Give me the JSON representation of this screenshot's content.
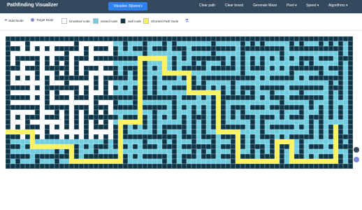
{
  "navbar": {
    "brand": "Pathfinding Visualizer",
    "visualize_button": "Visualize Dijkstra's",
    "links": [
      {
        "label": "Clear path"
      },
      {
        "label": "Clear board"
      },
      {
        "label": "Generate Maze"
      },
      {
        "label": "Pixel ▾"
      },
      {
        "label": "Speed ▾"
      },
      {
        "label": "Algorithms ▾"
      }
    ]
  },
  "legend": [
    {
      "label": "Start Node",
      "icon": "arrow-right-icon"
    },
    {
      "label": "Target Node",
      "icon": "target-icon"
    },
    {
      "label": "Unvisited node",
      "color": "#ffffff"
    },
    {
      "label": "visited node",
      "color": "#6fcde0"
    },
    {
      "label": "wall node",
      "color": "#0c3547"
    },
    {
      "label": "Shortest Path Node",
      "color": "#fff35a"
    },
    {
      "label": "",
      "icon": "flask-icon"
    }
  ],
  "colors": {
    "wall": "#0c3547",
    "unvisited": "#ffffff",
    "visited": "#6fcde0",
    "path": "#fff35a"
  }
}
